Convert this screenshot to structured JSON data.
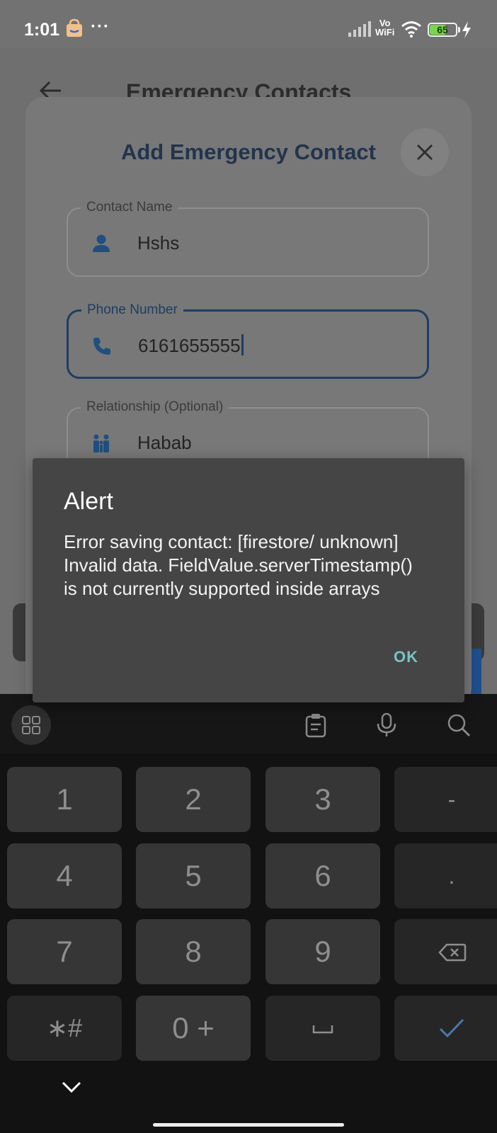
{
  "status_bar": {
    "time": "1:01",
    "dots": "···",
    "network": "Vo\nWiFi",
    "battery_level": "65",
    "battery_color": "#78d64b"
  },
  "background_screen": {
    "page_title": "Emergency Contacts"
  },
  "add_contact_dialog": {
    "title": "Add Emergency Contact",
    "fields": [
      {
        "label": "Contact Name",
        "value": "Hshs",
        "icon": "person-icon"
      },
      {
        "label": "Phone Number",
        "value": "6161655555",
        "icon": "phone-icon"
      },
      {
        "label": "Relationship (Optional)",
        "value": "Habab",
        "icon": "people-icon"
      }
    ]
  },
  "alert": {
    "title": "Alert",
    "message": "Error saving contact: [firestore/ unknown] Invalid data. FieldValue.serverTimestamp() is not currently supported inside arrays",
    "ok_label": "OK",
    "ok_color": "#7bc3c3"
  },
  "keyboard": {
    "toolbar_icons": [
      "apps-grid-icon",
      "clipboard-icon",
      "microphone-icon",
      "search-icon"
    ],
    "keys": {
      "k1": "1",
      "k2": "2",
      "k3": "3",
      "dash": "-",
      "k4": "4",
      "k5": "5",
      "k6": "6",
      "dot": ".",
      "k7": "7",
      "k8": "8",
      "k9": "9",
      "star_hash": "∗#",
      "k0": "0 +"
    }
  }
}
